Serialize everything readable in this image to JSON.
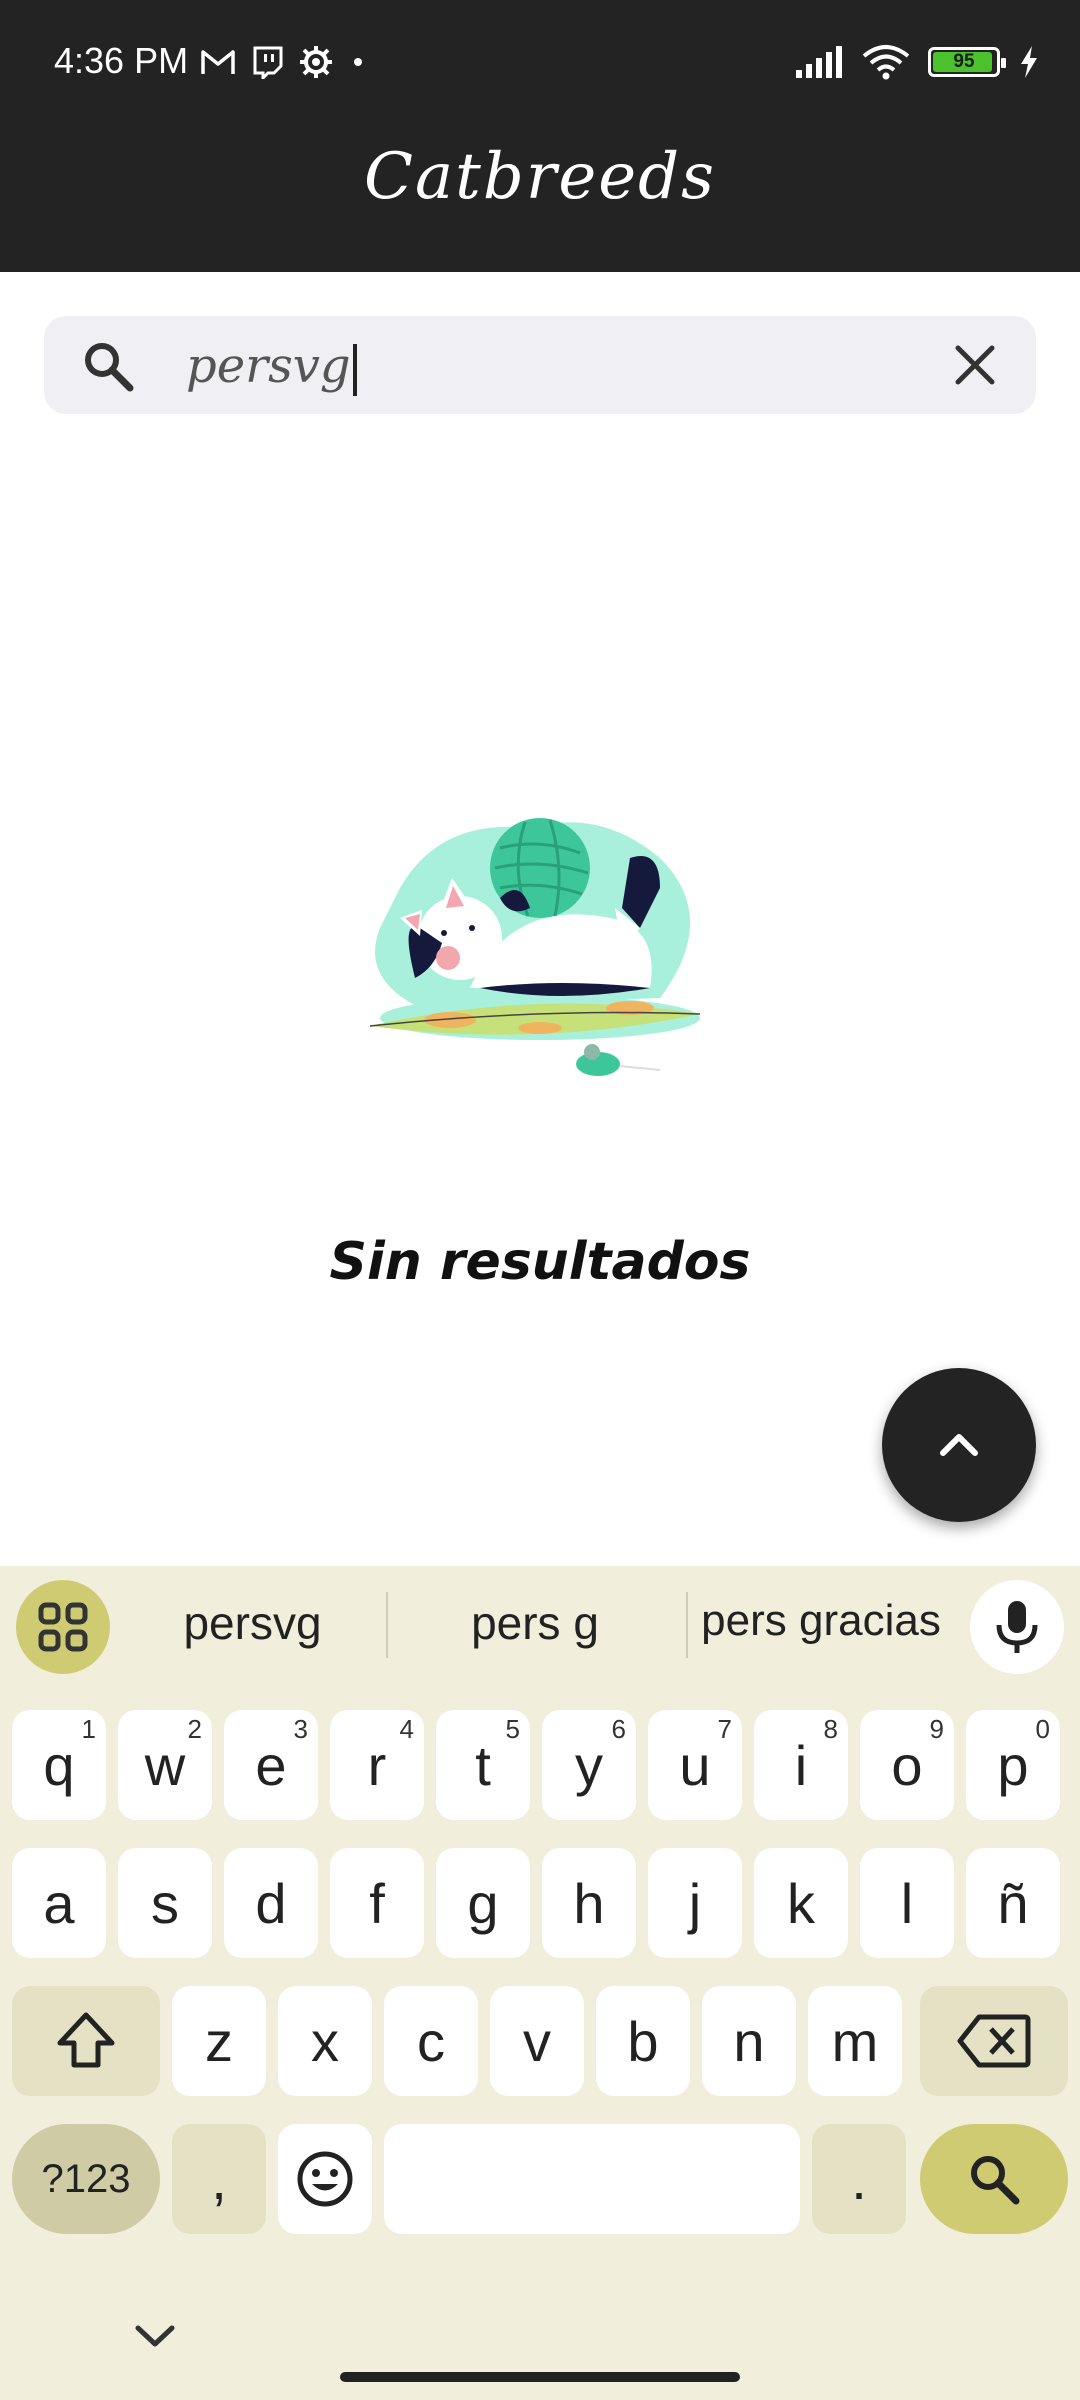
{
  "status_bar": {
    "time": "4:36 PM",
    "battery": "95",
    "battery_level": 0.95,
    "icons_left": [
      "gmail-icon",
      "twitch-icon",
      "settings-icon",
      "dot-icon"
    ],
    "icons_right": [
      "signal-icon",
      "wifi-icon",
      "battery-icon",
      "charging-icon"
    ]
  },
  "app_bar": {
    "title": "Catbreeds"
  },
  "search": {
    "value": "persvg",
    "icons": [
      "search-icon",
      "clear-icon"
    ]
  },
  "empty_state": {
    "message": "Sin resultados"
  },
  "fab": {
    "icon": "chevron-up-icon"
  },
  "keyboard": {
    "suggestions": [
      "persvg",
      "pers g",
      "pers gracias"
    ],
    "row1": [
      {
        "k": "q",
        "h": "1"
      },
      {
        "k": "w",
        "h": "2"
      },
      {
        "k": "e",
        "h": "3"
      },
      {
        "k": "r",
        "h": "4"
      },
      {
        "k": "t",
        "h": "5"
      },
      {
        "k": "y",
        "h": "6"
      },
      {
        "k": "u",
        "h": "7"
      },
      {
        "k": "i",
        "h": "8"
      },
      {
        "k": "o",
        "h": "9"
      },
      {
        "k": "p",
        "h": "0"
      }
    ],
    "row2": [
      "a",
      "s",
      "d",
      "f",
      "g",
      "h",
      "j",
      "k",
      "l",
      "ñ"
    ],
    "row3": [
      "z",
      "x",
      "c",
      "v",
      "b",
      "n",
      "m"
    ],
    "symbols_key": "?123",
    "comma_key": ",",
    "period_key": ".",
    "accent_color": "#cfcb73",
    "background_color": "#f2eedc"
  },
  "colors": {
    "app_bar": "#232323",
    "search_bg": "#f0eff4",
    "fab": "#232323"
  }
}
